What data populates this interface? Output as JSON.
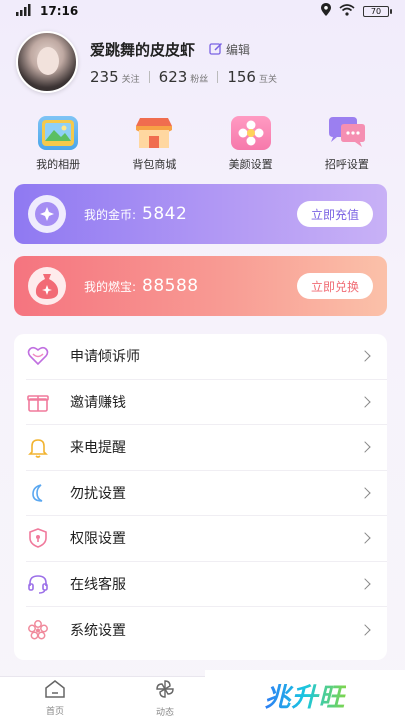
{
  "status_bar": {
    "network": "4G",
    "time": "17:16",
    "battery": "70"
  },
  "profile": {
    "nickname": "爱跳舞的皮皮虾",
    "edit_label": "编辑",
    "stats": [
      {
        "value": "235",
        "label": "关注"
      },
      {
        "value": "623",
        "label": "粉丝"
      },
      {
        "value": "156",
        "label": "互关"
      }
    ]
  },
  "quick_actions": [
    {
      "label": "我的相册",
      "icon": "photo-album-icon"
    },
    {
      "label": "背包商城",
      "icon": "shop-icon"
    },
    {
      "label": "美颜设置",
      "icon": "beauty-icon"
    },
    {
      "label": "招呼设置",
      "icon": "greeting-chat-icon"
    }
  ],
  "coin_card": {
    "label": "我的金币:",
    "value": "5842",
    "button": "立即充值",
    "icon": "coin-icon"
  },
  "treasure_card": {
    "label": "我的燃宝:",
    "value": "88588",
    "button": "立即兑换",
    "icon": "money-bag-icon"
  },
  "menu": [
    {
      "label": "申请倾诉师",
      "icon": "heart-chat-icon"
    },
    {
      "label": "邀请赚钱",
      "icon": "gift-icon"
    },
    {
      "label": "来电提醒",
      "icon": "bell-icon"
    },
    {
      "label": "勿扰设置",
      "icon": "moon-icon"
    },
    {
      "label": "权限设置",
      "icon": "shield-icon"
    },
    {
      "label": "在线客服",
      "icon": "headset-icon"
    },
    {
      "label": "系统设置",
      "icon": "settings-flower-icon"
    }
  ],
  "tabbar": [
    {
      "label": "首页",
      "icon": "home-icon"
    },
    {
      "label": "动态",
      "icon": "pinwheel-icon"
    }
  ],
  "watermark": "兆升旺",
  "colors": {
    "coin_card": "#9b83f3",
    "treasure_card": "#f6807f",
    "background": "#f3eefb"
  }
}
